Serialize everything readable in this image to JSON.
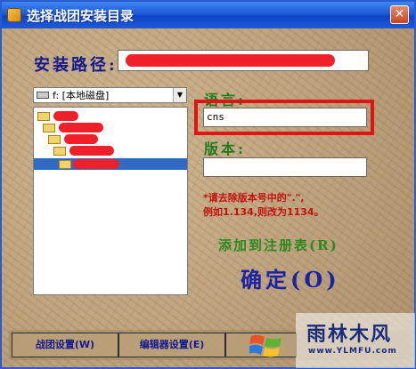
{
  "window": {
    "title": "选择战团安装目录",
    "close_symbol": "✕",
    "accent": "#2a5bd1"
  },
  "install_path": {
    "label": "安装路径:",
    "value": ""
  },
  "drive_select": {
    "value": "f: [本地磁盘]",
    "arrow": "▼"
  },
  "language": {
    "label": "语言:",
    "value": "cns"
  },
  "version": {
    "label": "版本:",
    "value": ""
  },
  "note": {
    "line1": "*请去除版本号中的\".\",",
    "line2": "例如1.134,则改为1134。"
  },
  "buttons": {
    "add_registry": "添加到注册表(R)",
    "ok": "确定(O)",
    "troop_settings": "战团设置(W)",
    "editor_settings": "编辑器设置(E)"
  },
  "watermark": {
    "title": "雨林木风",
    "url": "www.YLMFU.com"
  },
  "colors": {
    "highlight_border": "#e01414",
    "label_green": "#1f7a1f",
    "label_blue": "#13188f",
    "note_red": "#c41010"
  }
}
